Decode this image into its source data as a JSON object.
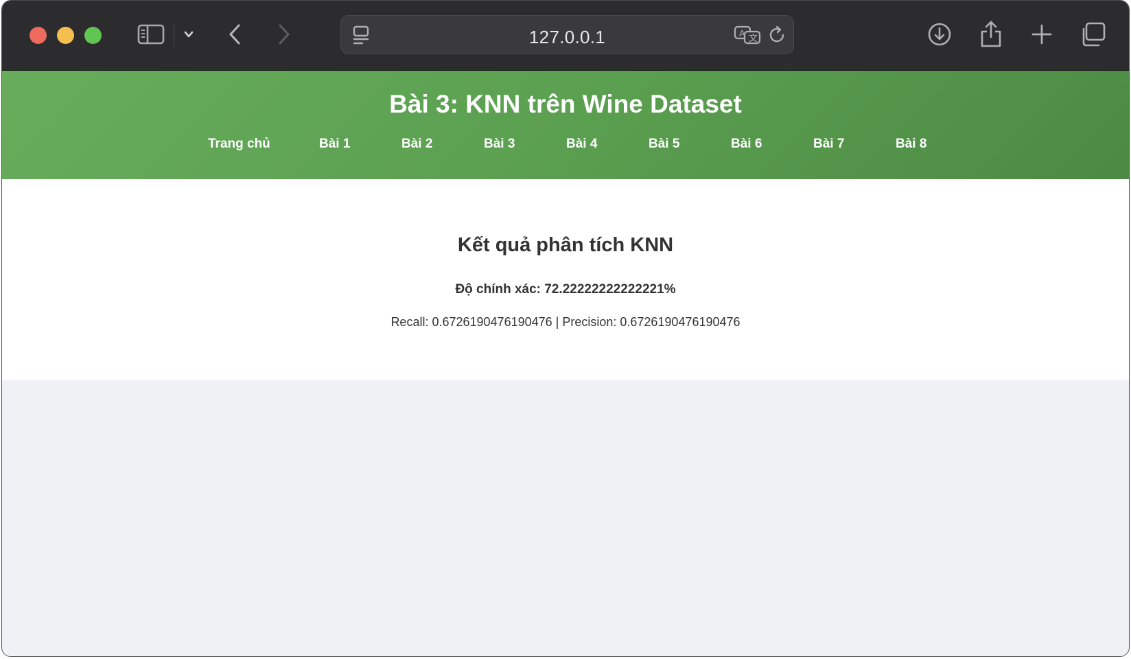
{
  "browser": {
    "url": "127.0.0.1"
  },
  "header": {
    "title": "Bài 3: KNN trên Wine Dataset",
    "nav": [
      {
        "label": "Trang chủ"
      },
      {
        "label": "Bài 1"
      },
      {
        "label": "Bài 2"
      },
      {
        "label": "Bài 3"
      },
      {
        "label": "Bài 4"
      },
      {
        "label": "Bài 5"
      },
      {
        "label": "Bài 6"
      },
      {
        "label": "Bài 7"
      },
      {
        "label": "Bài 8"
      }
    ]
  },
  "result": {
    "heading": "Kết quả phân tích KNN",
    "accuracy": "Độ chính xác: 72.22222222222221%",
    "metrics": "Recall: 0.6726190476190476 | Precision: 0.6726190476190476"
  },
  "colors": {
    "header_green": "#5b9f50",
    "page_background": "#eff1f5",
    "toolbar": "#2c2c2e"
  },
  "icons": {
    "sidebar": "sidebar-icon",
    "chevron": "chevron-down-icon",
    "back": "back-arrow-icon",
    "forward": "forward-arrow-icon",
    "page_menu": "page-menu-icon",
    "translate": "translate-icon",
    "reload": "reload-icon",
    "download": "download-icon",
    "share": "share-icon",
    "new_tab": "plus-icon",
    "tabs": "tab-overview-icon"
  }
}
